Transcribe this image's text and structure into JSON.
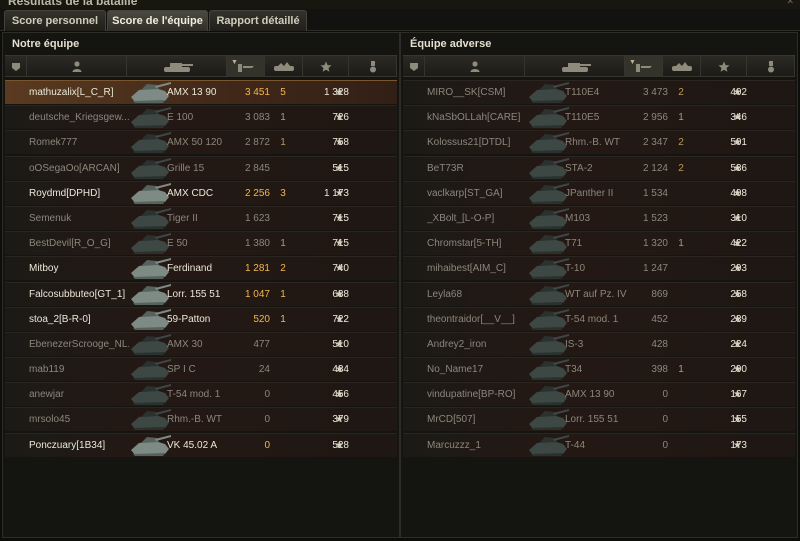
{
  "window": {
    "title": "Résultats de la bataille"
  },
  "tabs": [
    {
      "label": "Score personnel",
      "active": false
    },
    {
      "label": "Score de l'équipe",
      "active": true
    },
    {
      "label": "Rapport détaillé",
      "active": false
    }
  ],
  "colors": {
    "highlight_row": "#5a3b20",
    "damage_gold": "#f2b84a",
    "dead_text": "#8b877b",
    "alive_text": "#ece8da"
  },
  "icons": [
    "squad-icon",
    "player-icon",
    "vehicle-icon",
    "damage-icon",
    "kills-icon",
    "experience-star-icon",
    "medal-icon"
  ],
  "teams": {
    "ally": {
      "title": "Notre équipe",
      "rows": [
        {
          "player": "mathuzalix[L_C_R]",
          "tank": "AMX 13 90",
          "damage": "3 451",
          "kills": "5",
          "xp": "1 328",
          "alive": true,
          "highlight": true
        },
        {
          "player": "deutsche_Kriegsgew...",
          "tank": "E 100",
          "damage": "3 083",
          "kills": "1",
          "xp": "726",
          "alive": false
        },
        {
          "player": "Romek777",
          "tank": "AMX 50 120",
          "damage": "2 872",
          "kills": "1",
          "xp": "758",
          "alive": false
        },
        {
          "player": "oOSegaOo[ARCAN]",
          "tank": "Grille 15",
          "damage": "2 845",
          "kills": "",
          "xp": "515",
          "alive": false
        },
        {
          "player": "Roydmd[DPHD]",
          "tank": "AMX CDC",
          "damage": "2 256",
          "kills": "3",
          "xp": "1 173",
          "alive": true
        },
        {
          "player": "Semenuk",
          "tank": "Tiger II",
          "damage": "1 623",
          "kills": "",
          "xp": "715",
          "alive": false
        },
        {
          "player": "BestDevil[R_O_G]",
          "tank": "E 50",
          "damage": "1 380",
          "kills": "1",
          "xp": "715",
          "alive": false
        },
        {
          "player": "Mitboy",
          "tank": "Ferdinand",
          "damage": "1 281",
          "kills": "2",
          "xp": "740",
          "alive": true
        },
        {
          "player": "Falcosubbuteo[GT_1]",
          "tank": "Lorr. 155 51",
          "damage": "1 047",
          "kills": "1",
          "xp": "638",
          "alive": true
        },
        {
          "player": "stoa_2[B-R-0]",
          "tank": "59-Patton",
          "damage": "520",
          "kills": "1",
          "xp": "722",
          "alive": true
        },
        {
          "player": "EbenezerScrooge_NL...",
          "tank": "AMX 30",
          "damage": "477",
          "kills": "",
          "xp": "510",
          "alive": false
        },
        {
          "player": "mab119",
          "tank": "SP I C",
          "damage": "24",
          "kills": "",
          "xp": "434",
          "alive": false
        },
        {
          "player": "anewjar",
          "tank": "T-54 mod. 1",
          "damage": "0",
          "kills": "",
          "xp": "456",
          "alive": false
        },
        {
          "player": "mrsolo45",
          "tank": "Rhm.-B. WT",
          "damage": "0",
          "kills": "",
          "xp": "379",
          "alive": false
        },
        {
          "player": "Ponczuary[1B34]",
          "tank": "VK 45.02 A",
          "damage": "0",
          "kills": "",
          "xp": "528",
          "alive": true
        }
      ]
    },
    "enemy": {
      "title": "Équipe adverse",
      "rows": [
        {
          "player": "MIRO__SK[CSM]",
          "tank": "T110E4",
          "damage": "3 473",
          "kills": "2",
          "xp": "402",
          "alive": false
        },
        {
          "player": "kNaSbOLLah[CARE]",
          "tank": "T110E5",
          "damage": "2 956",
          "kills": "1",
          "xp": "346",
          "alive": false
        },
        {
          "player": "Kolossus21[DTDL]",
          "tank": "Rhm.-B. WT",
          "damage": "2 347",
          "kills": "2",
          "xp": "501",
          "alive": false
        },
        {
          "player": "BeT73R",
          "tank": "STA-2",
          "damage": "2 124",
          "kills": "2",
          "xp": "536",
          "alive": false
        },
        {
          "player": "vaclkarp[ST_GA]",
          "tank": "JPanther II",
          "damage": "1 534",
          "kills": "",
          "xp": "408",
          "alive": false
        },
        {
          "player": "_XBolt_[L-O-P]",
          "tank": "M103",
          "damage": "1 523",
          "kills": "",
          "xp": "310",
          "alive": false
        },
        {
          "player": "Chromstar[5-TH]",
          "tank": "T71",
          "damage": "1 320",
          "kills": "1",
          "xp": "422",
          "alive": false
        },
        {
          "player": "mihaibest[AIM_C]",
          "tank": "T-10",
          "damage": "1 247",
          "kills": "",
          "xp": "293",
          "alive": false
        },
        {
          "player": "Leyla68",
          "tank": "WT auf Pz. IV",
          "damage": "869",
          "kills": "",
          "xp": "258",
          "alive": false
        },
        {
          "player": "theontraidor[__V__]",
          "tank": "T-54 mod. 1",
          "damage": "452",
          "kills": "",
          "xp": "239",
          "alive": false
        },
        {
          "player": "Andrey2_iron",
          "tank": "IS-3",
          "damage": "428",
          "kills": "",
          "xp": "224",
          "alive": false
        },
        {
          "player": "No_Name17",
          "tank": "T34",
          "damage": "398",
          "kills": "1",
          "xp": "290",
          "alive": false
        },
        {
          "player": "vindupatine[BP-RO]",
          "tank": "AMX 13 90",
          "damage": "0",
          "kills": "",
          "xp": "167",
          "alive": false
        },
        {
          "player": "MrCD[507]",
          "tank": "Lorr. 155 51",
          "damage": "0",
          "kills": "",
          "xp": "155",
          "alive": false
        },
        {
          "player": "Marcuzzz_1",
          "tank": "T-44",
          "damage": "0",
          "kills": "",
          "xp": "173",
          "alive": false
        }
      ]
    }
  }
}
